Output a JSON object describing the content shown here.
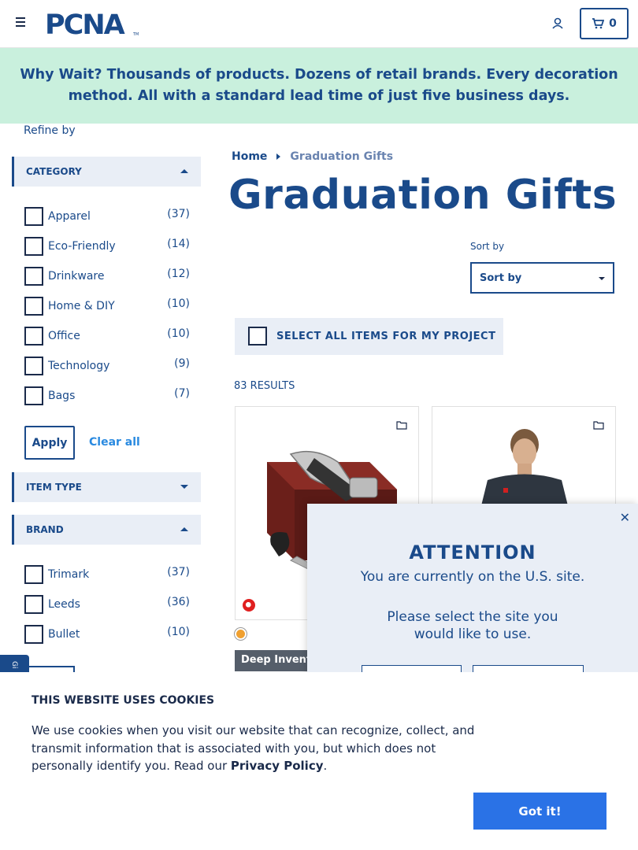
{
  "header": {
    "logo_text": "PCNA",
    "cart_count": "0"
  },
  "banner": {
    "lead": "Why Wait?",
    "text": "Thousands of products. Dozens of retail brands. Every decoration method. All with a standard lead time of just five business days."
  },
  "sidebar": {
    "refine_label": "Refine by",
    "category": {
      "title": "CATEGORY",
      "items": [
        {
          "label": "Apparel",
          "count": "(37)"
        },
        {
          "label": "Eco-Friendly",
          "count": "(14)"
        },
        {
          "label": "Drinkware",
          "count": "(12)"
        },
        {
          "label": "Home & DIY",
          "count": "(10)"
        },
        {
          "label": "Office",
          "count": "(10)"
        },
        {
          "label": "Technology",
          "count": "(9)"
        },
        {
          "label": "Bags",
          "count": "(7)"
        }
      ],
      "apply_label": "Apply",
      "clear_label": "Clear all"
    },
    "item_type": {
      "title": "ITEM TYPE"
    },
    "brand": {
      "title": "BRAND",
      "items": [
        {
          "label": "Trimark",
          "count": "(37)"
        },
        {
          "label": "Leeds",
          "count": "(36)"
        },
        {
          "label": "Bullet",
          "count": "(10)"
        }
      ]
    },
    "side_tab": "Gi"
  },
  "main": {
    "breadcrumb": {
      "home": "Home",
      "current": "Graduation Gifts"
    },
    "title": "Graduation Gifts",
    "sort": {
      "label": "Sort by",
      "value": "Sort by"
    },
    "select_all_label": "SELECT ALL ITEMS FOR MY PROJECT",
    "results": "83 RESULTS",
    "tag": "Deep Inventory"
  },
  "modal": {
    "title": "ATTENTION",
    "subtitle": "You are currently on the U.S. site.",
    "prompt": "Please select the site you would like to use.",
    "close": "✕"
  },
  "cookie": {
    "title": "THIS WEBSITE USES COOKIES",
    "text": "We use cookies when you visit our website that can recognize, collect, and transmit information that is associated with you, but which does not personally identify you. Read our ",
    "link": "Privacy Policy",
    "period": ".",
    "button": "Got it!"
  },
  "colors": {
    "brand_navy": "#1a4a8a",
    "banner_bg": "#c9f0dd",
    "cookie_button": "#2a72e6"
  }
}
